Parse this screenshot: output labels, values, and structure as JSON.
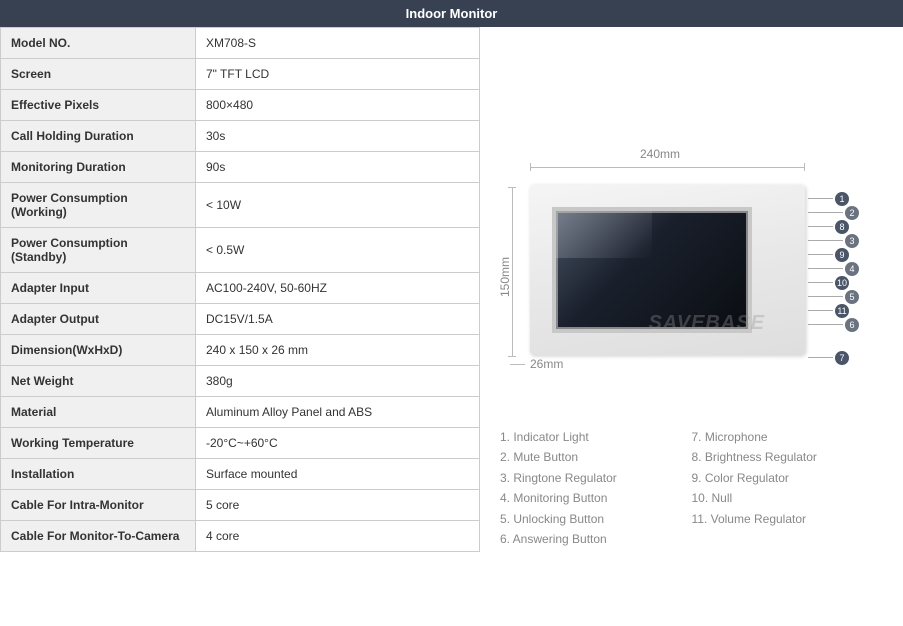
{
  "header": {
    "title": "Indoor Monitor"
  },
  "specs": [
    {
      "label": "Model NO.",
      "value": "XM708-S"
    },
    {
      "label": "Screen",
      "value": "7\" TFT LCD"
    },
    {
      "label": "Effective Pixels",
      "value": "800×480"
    },
    {
      "label": "Call Holding Duration",
      "value": "30s"
    },
    {
      "label": "Monitoring Duration",
      "value": "90s"
    },
    {
      "label": "Power Consumption (Working)",
      "value": "< 10W"
    },
    {
      "label": "Power Consumption (Standby)",
      "value": "< 0.5W"
    },
    {
      "label": "Adapter Input",
      "value": "AC100-240V, 50-60HZ"
    },
    {
      "label": "Adapter Output",
      "value": "DC15V/1.5A"
    },
    {
      "label": "Dimension(WxHxD)",
      "value": "240 x 150 x 26 mm"
    },
    {
      "label": "Net Weight",
      "value": "380g"
    },
    {
      "label": "Material",
      "value": "Aluminum Alloy Panel and ABS"
    },
    {
      "label": "Working Temperature",
      "value": "-20°C~+60°C"
    },
    {
      "label": "Installation",
      "value": "Surface mounted"
    },
    {
      "label": "Cable For Intra-Monitor",
      "value": "5 core"
    },
    {
      "label": "Cable For Monitor-To-Camera",
      "value": "4 core"
    }
  ],
  "diagram": {
    "width_label": "240mm",
    "height_label": "150mm",
    "depth_label": "26mm",
    "watermark": "SAVEBASE",
    "callouts": [
      "1",
      "2",
      "8",
      "3",
      "9",
      "4",
      "10",
      "5",
      "11",
      "6",
      "7"
    ]
  },
  "legend_left": [
    "1. Indicator Light",
    "2. Mute Button",
    "3. Ringtone Regulator",
    "4. Monitoring Button",
    "5. Unlocking Button",
    "6. Answering Button"
  ],
  "legend_right": [
    "7. Microphone",
    "8. Brightness Regulator",
    "9. Color Regulator",
    "10. Null",
    "11. Volume Regulator"
  ]
}
